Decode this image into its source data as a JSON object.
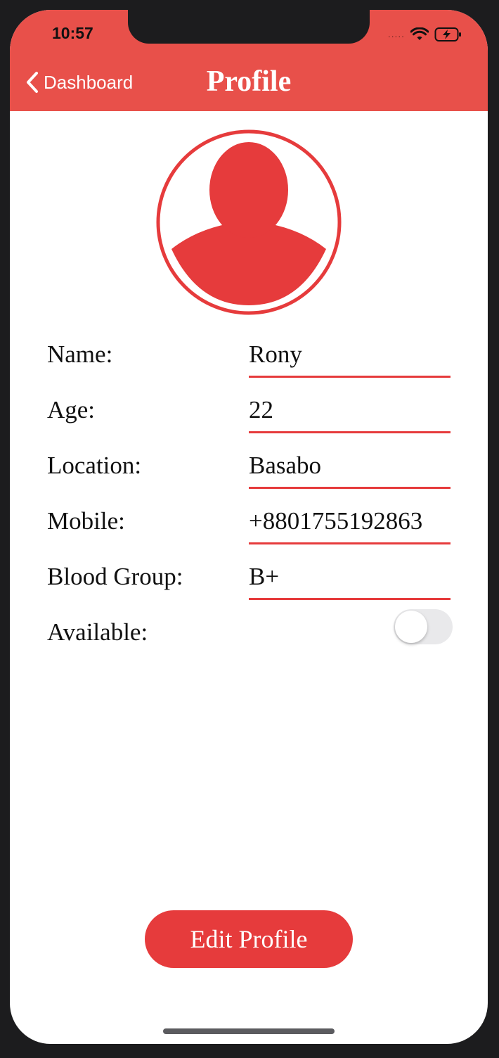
{
  "status_bar": {
    "time": "10:57",
    "signal": ".....",
    "icons": [
      "wifi-icon",
      "battery-charging-icon"
    ]
  },
  "nav": {
    "back_label": "Dashboard",
    "title": "Profile",
    "back_icon": "chevron-left-icon"
  },
  "avatar": {
    "icon": "user-avatar-icon"
  },
  "fields": [
    {
      "label": "Name:",
      "value": "Rony"
    },
    {
      "label": "Age:",
      "value": "22"
    },
    {
      "label": "Location:",
      "value": "Basabo"
    },
    {
      "label": "Mobile:",
      "value": "+8801755192863"
    },
    {
      "label": "Blood Group:",
      "value": "B+"
    }
  ],
  "available": {
    "label": "Available:",
    "on": false
  },
  "actions": {
    "edit_label": "Edit Profile"
  },
  "colors": {
    "header": "#e8504a",
    "accent": "#e63b3c",
    "toggle_off": "#e9e9eb"
  }
}
